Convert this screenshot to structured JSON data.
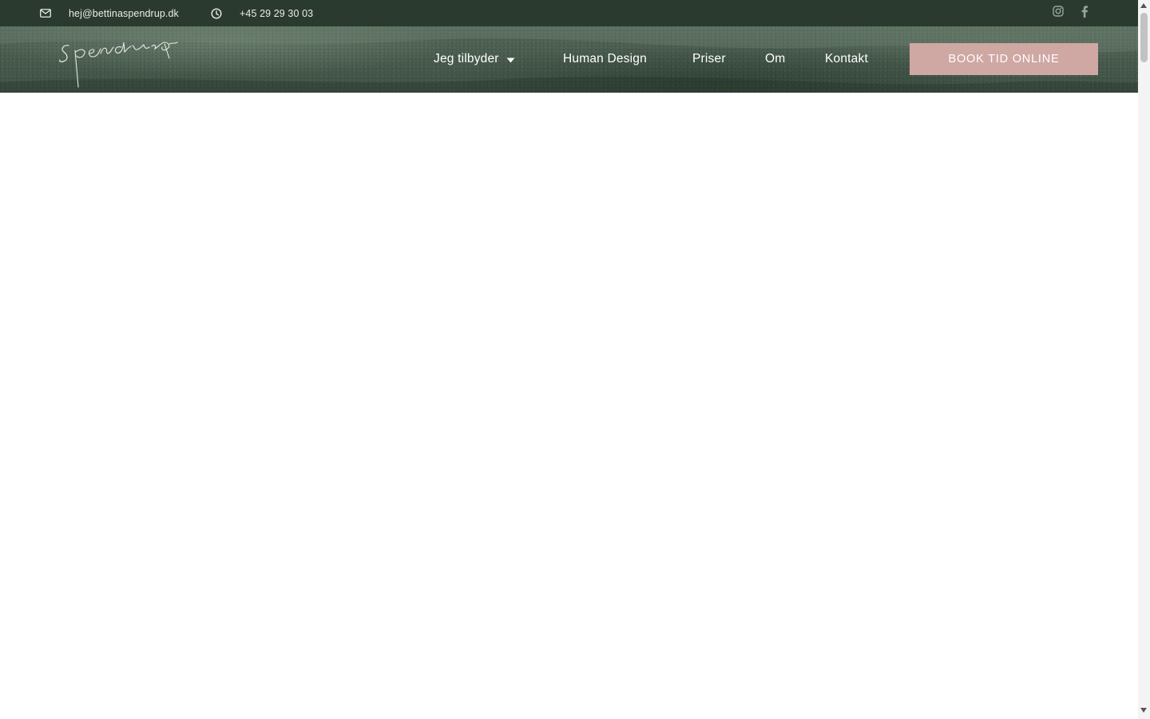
{
  "topbar": {
    "email": "hej@bettinaspendrup.dk",
    "phone": "+45 29 29 30 03",
    "email_icon": "envelope-icon",
    "phone_icon": "clock-icon",
    "social": [
      "instagram-icon",
      "facebook-icon"
    ]
  },
  "header": {
    "logo_icon": "spendrup-signature-logo",
    "nav": {
      "jeg_tilbyder": "Jeg tilbyder",
      "human_design": "Human Design",
      "priser": "Priser",
      "om": "Om",
      "kontakt": "Kontakt"
    },
    "cta": "BOOK TID ONLINE"
  },
  "colors": {
    "topbar_bg": "#2b3a2f",
    "header_bg": "#4a5d4f",
    "cta_bg": "#cfa7a3",
    "text_light": "#ffffff"
  }
}
